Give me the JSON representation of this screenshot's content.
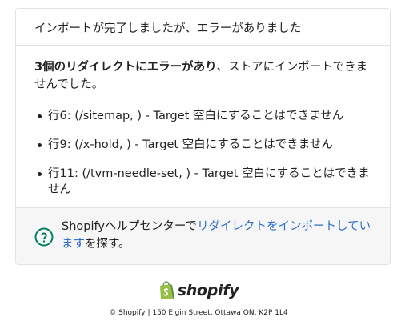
{
  "header": {
    "title": "インポートが完了しましたが、エラーがありました"
  },
  "summary": {
    "bold": "3個のリダイレクトにエラーがあり",
    "rest": "、ストアにインポートできませんでした。"
  },
  "errors": [
    "行6: (/sitemap, ) - Target 空白にすることはできません",
    "行9: (/x-hold, ) - Target 空白にすることはできません",
    "行11: (/tvm-needle-set, ) - Target 空白にすることはできません"
  ],
  "help": {
    "prefix": "Shopifyヘルプセンターで",
    "link": "リダイレクトをインポートしています",
    "suffix": "を探す。"
  },
  "brand": {
    "wordmark": "shopify"
  },
  "footer": {
    "address": "© Shopify | 150 Elgin Street, Ottawa ON, K2P 1L4"
  },
  "colors": {
    "accent": "#2c6ecb",
    "help_icon": "#008060",
    "brand_green": "#95bf47"
  }
}
